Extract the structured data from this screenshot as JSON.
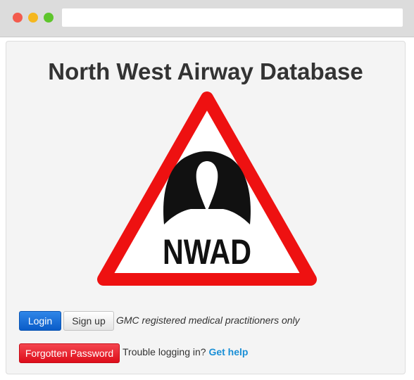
{
  "page": {
    "title": "North West Airway Database"
  },
  "logo": {
    "text": "NWAD",
    "colors": {
      "border": "#ee1111",
      "fill": "#ffffff",
      "symbol": "#111111"
    }
  },
  "auth": {
    "login_label": "Login",
    "signup_label": "Sign up",
    "note": "GMC registered medical practitioners only",
    "forgot_label": "Forgotten Password",
    "trouble_text": "Trouble logging in?",
    "help_link": "Get help"
  },
  "colors": {
    "login": "#0a5cc8",
    "forgot": "#dd0d1a",
    "link": "#1a8fd6"
  }
}
